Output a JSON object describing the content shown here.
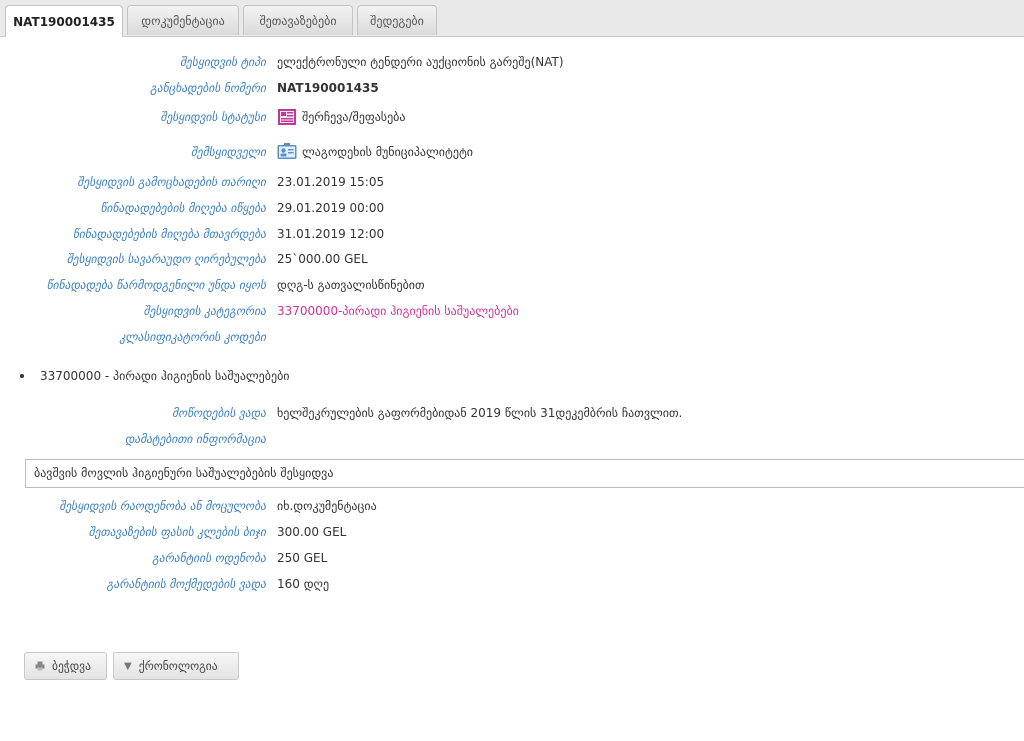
{
  "tabs": [
    {
      "label": "NAT190001435"
    },
    {
      "label": "დოკუმენტაცია"
    },
    {
      "label": "შეთავაზებები"
    },
    {
      "label": "შედეგები"
    }
  ],
  "details": {
    "type": {
      "label": "შესყიდვის ტიპი",
      "value": "ელექტრონული ტენდერი აუქციონის გარეშე(NAT)"
    },
    "number": {
      "label": "განცხადების ნომერი",
      "value": "NAT190001435"
    },
    "status": {
      "label": "შესყიდვის სტატუსი",
      "value": "შერჩევა/შეფასება"
    },
    "buyer": {
      "label": "შემსყიდველი",
      "value": "ლაგოდეხის მუნიციპალიტეტი"
    },
    "announced": {
      "label": "შესყიდვის გამოცხადების თარიღი",
      "value": "23.01.2019 15:05"
    },
    "bid_start": {
      "label": "წინადადებების მიღება იწყება",
      "value": "29.01.2019 00:00"
    },
    "bid_end": {
      "label": "წინადადებების მიღება მთავრდება",
      "value": "31.01.2019 12:00"
    },
    "est_value": {
      "label": "შესყიდვის სავარაუდო ღირებულება",
      "value": "25`000.00 GEL"
    },
    "bid_vat": {
      "label": "წინადადება წარმოდგენილი უნდა იყოს",
      "value": "დღგ-ს გათვალისწინებით"
    },
    "category": {
      "label": "შესყიდვის კატეგორია",
      "value": "33700000-პირადი ჰიგიენის საშუალებები"
    },
    "class_codes": {
      "label": "კლასიფიკატორის კოდები",
      "value": ""
    }
  },
  "codes_list": [
    "33700000 - პირადი ჰიგიენის საშუალებები"
  ],
  "delivery": {
    "label": "მოწოდების ვადა",
    "value": "ხელშეკრულების გაფორმებიდან 2019 წლის 31დეკემბრის ჩათვლით."
  },
  "additional": {
    "label": "დამატებითი ინფორმაცია",
    "box_text": "ბავშვის მოვლის ჰიგიენური საშუალებების შესყიდვა"
  },
  "extra": {
    "quantity": {
      "label": "შესყიდვის რაოდენობა ან მოცულობა",
      "value": "იხ.დოკუმენტაცია"
    },
    "price_step": {
      "label": "შეთავაზების ფასის კლების ბიჯი",
      "value": "300.00 GEL"
    },
    "guarantee": {
      "label": "გარანტიის ოდენობა",
      "value": "250 GEL"
    },
    "guarantee_term": {
      "label": "გარანტიის მოქმედების ვადა",
      "value": "160 დღე"
    }
  },
  "buttons": {
    "print": "ბეჭდვა",
    "chronology": "ქრონოლოგია"
  },
  "icons": {
    "status": "document-list-icon",
    "buyer": "contact-card-icon",
    "print": "printer-icon",
    "chronology": "caret-down-icon"
  },
  "colors": {
    "label": "#3a7fbf",
    "category": "#cc3399",
    "status_icon": "#c0399a",
    "buyer_icon": "#5b8fc7"
  }
}
